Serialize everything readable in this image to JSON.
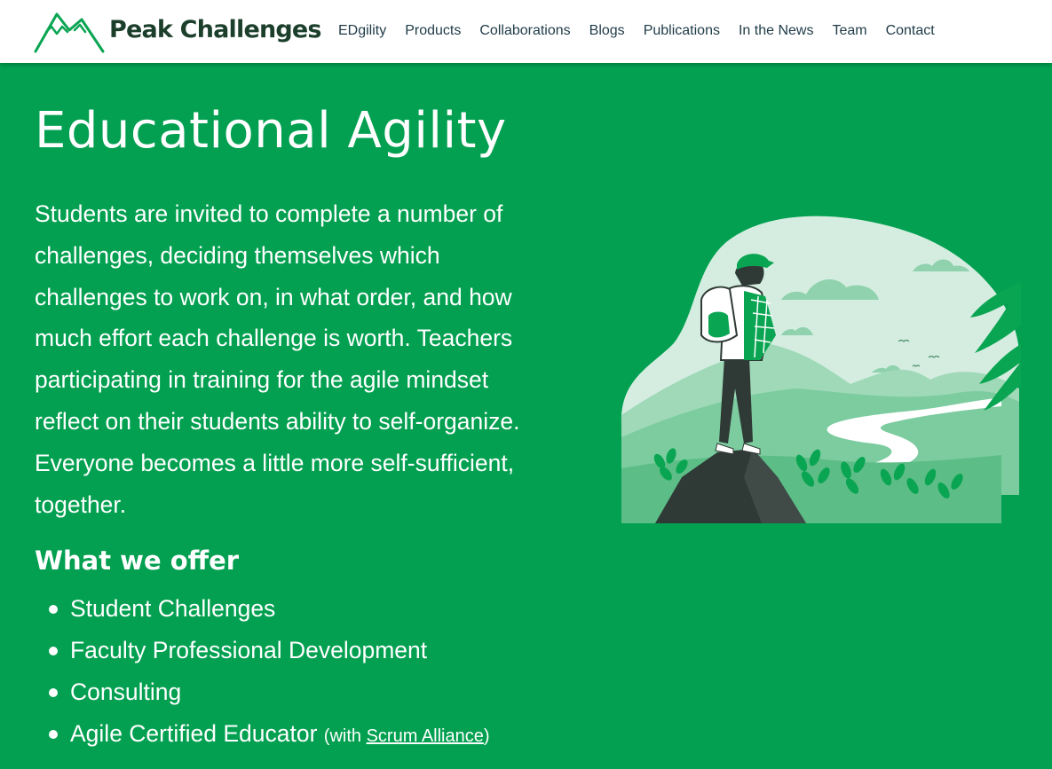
{
  "header": {
    "brand": "Peak Challenges",
    "nav": [
      "EDgility",
      "Products",
      "Collaborations",
      "Blogs",
      "Publications",
      "In the News",
      "Team",
      "Contact"
    ]
  },
  "hero": {
    "title": "Educational Agility",
    "intro": "Students are invited to complete a number of challenges, deciding themselves which challenges to work on, in what order, and how much effort each challenge is worth. Teachers participating in training for the agile mindset reflect on their students ability to self-organize. Everyone becomes a little more self-sufficient, together."
  },
  "offer": {
    "title": "What we offer",
    "items": [
      "Student Challenges",
      "Faculty Professional Development",
      "Consulting"
    ],
    "last_item": {
      "label": "Agile Certified Educator",
      "prefix": "(with ",
      "link": "Scrum Alliance",
      "suffix": ")"
    }
  },
  "colors": {
    "page_bg": "#02a050",
    "header_bg": "#ffffff",
    "brand_text": "#1c3f2b",
    "nav_text": "#1f3b47",
    "logo_green": "#0aa552"
  },
  "icons": {
    "logo": "mountain-logo-icon",
    "illustration": "hiker-on-mountain-illustration"
  }
}
